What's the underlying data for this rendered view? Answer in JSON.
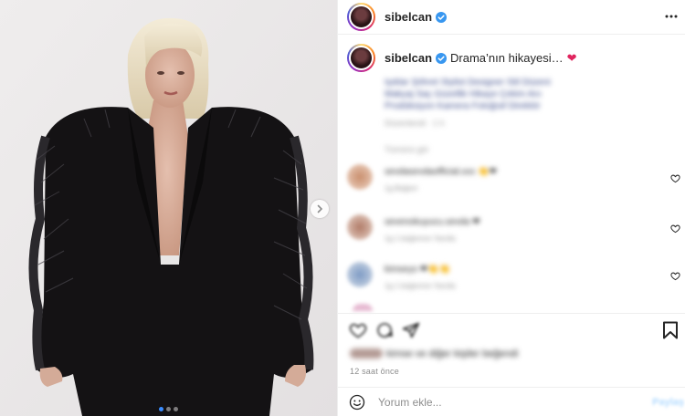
{
  "post": {
    "username": "sibelcan",
    "caption": {
      "username": "sibelcan",
      "text": "Drama’nın hikayesi…",
      "emoji": "❤"
    },
    "caption_blurred_lines": [
      "Işıklar Şöhret Stylist Designer Stil Düzeni",
      "Makyaj Saç Güzellik Hikaye Çekim Anı",
      "Prodüksiyon Kamera Fotoğraf Direktör"
    ],
    "caption_meta": "Düzenlendi · 1 h",
    "view_replies": "Tümünü gör",
    "comments": [
      {
        "user": "sevdasevdaofficial.xxx",
        "emoji": "👏❤",
        "meta": "1g   Beğeni"
      },
      {
        "user": "sevenokuyucu.sevda",
        "emoji": "❤",
        "meta": "1g   1 beğenme   Yanıtla"
      },
      {
        "user": "kimseys",
        "emoji": "❤👏👏",
        "meta": "1g   1 beğenme   Yanıtla"
      }
    ],
    "likes_text": "kimse ve diğer kişiler beğendi",
    "time_ago": "12 saat önce",
    "comment_placeholder": "Yorum ekle...",
    "post_label": "Paylaş"
  },
  "carousel": {
    "count": 3,
    "active_index": 0
  },
  "colors": {
    "verified": "#3897f0",
    "heart": "#e0245e",
    "post_button": "#b3dbff",
    "carousel_active": "#3a8cff"
  },
  "icons": [
    "verified-icon",
    "more-options-icon",
    "chevron-right-icon",
    "heart-icon",
    "like-icon",
    "comment-icon",
    "share-icon",
    "bookmark-icon",
    "emoji-icon"
  ]
}
